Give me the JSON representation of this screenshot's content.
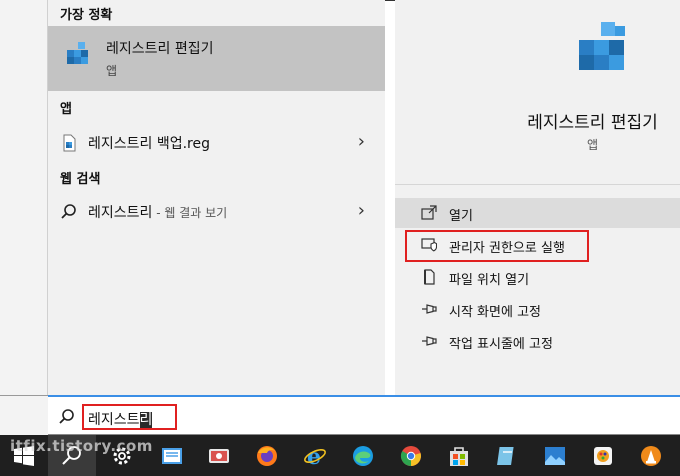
{
  "results": {
    "best_match_header": "가장 정확",
    "best_match": {
      "title": "레지스트리 편집기",
      "subtitle": "앱"
    },
    "apps_header": "앱",
    "apps": [
      {
        "label": "레지스트리 백업.reg"
      }
    ],
    "web_header": "웹 검색",
    "web": [
      {
        "label": "레지스트리",
        "hint": " - 웹 결과 보기"
      }
    ]
  },
  "detail": {
    "app_name": "레지스트리 편집기",
    "app_type": "앱",
    "actions": [
      {
        "label": "열기"
      },
      {
        "label": "관리자 권한으로 실행"
      },
      {
        "label": "파일 위치 열기"
      },
      {
        "label": "시작 화면에 고정"
      },
      {
        "label": "작업 표시줄에 고정"
      }
    ]
  },
  "search": {
    "typed": "레지스트",
    "selected": "리"
  },
  "watermark": "itfix.tistory.com",
  "colors": {
    "accent": "#3a8ee6",
    "highlight": "#e02020",
    "selected_row": "#c3c3c3"
  }
}
